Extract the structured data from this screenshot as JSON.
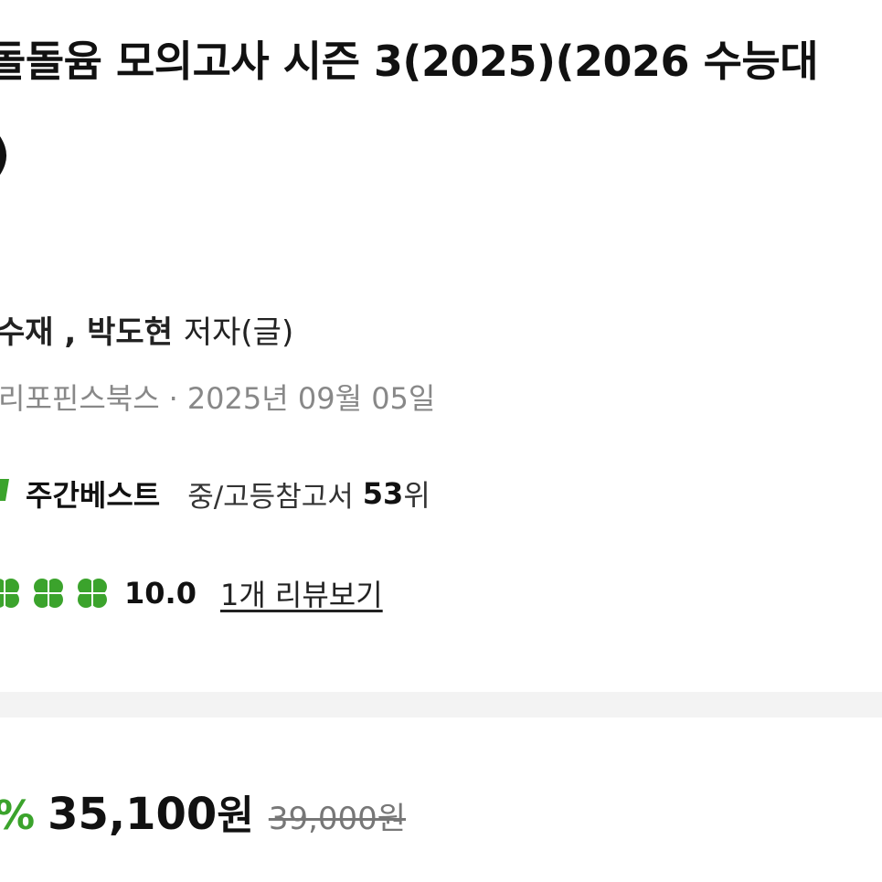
{
  "product": {
    "title_line1": "돌돌윰 모의고사 시즌 3(2025)(2026 수능대",
    "title_line2": ")",
    "author": "수재 , 박도현",
    "author_role": "저자(글)",
    "publisher": "리포핀스북스",
    "separator": "·",
    "pub_date": "2025년 09월 05일"
  },
  "bestseller": {
    "icon": "bestseller-badge-icon",
    "label": "주간베스트",
    "category": "중/고등참고서",
    "rank": "53",
    "rank_suffix": "위"
  },
  "rating": {
    "icon": "clover-icon",
    "score": "10.0",
    "review_link": "1개 리뷰보기",
    "color": "#3ba32c"
  },
  "price": {
    "discount": "%",
    "sale": "35,100",
    "unit": "원",
    "original": "39,000원",
    "accent_color": "#3ba32c"
  }
}
